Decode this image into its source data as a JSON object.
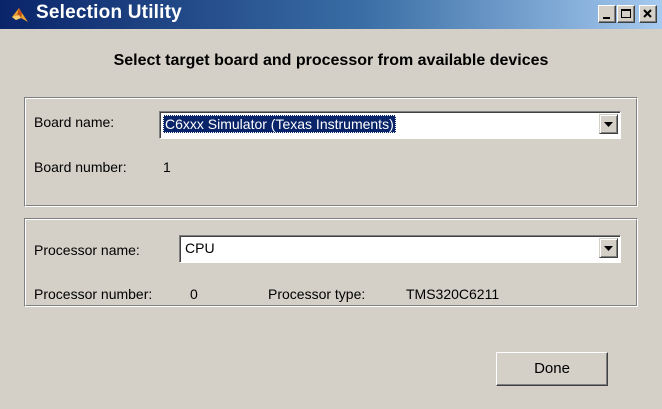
{
  "window": {
    "title": "Selection Utility",
    "icon": "matlab-icon",
    "controls": [
      "minimize-icon",
      "maximize-icon",
      "close-icon"
    ]
  },
  "heading": "Select target board and processor from available devices",
  "board": {
    "name_label": "Board name:",
    "name_value": "C6xxx Simulator (Texas Instruments)",
    "number_label": "Board number:",
    "number_value": "1"
  },
  "processor": {
    "name_label": "Processor name:",
    "name_value": "CPU",
    "number_label": "Processor number:",
    "number_value": "0",
    "type_label": "Processor type:",
    "type_value": "TMS320C6211"
  },
  "done_button": "Done",
  "colors": {
    "face": "#d4d0c8",
    "titlebar_start": "#0a246a",
    "titlebar_end": "#a6caf0",
    "selection": "#0a246a"
  }
}
